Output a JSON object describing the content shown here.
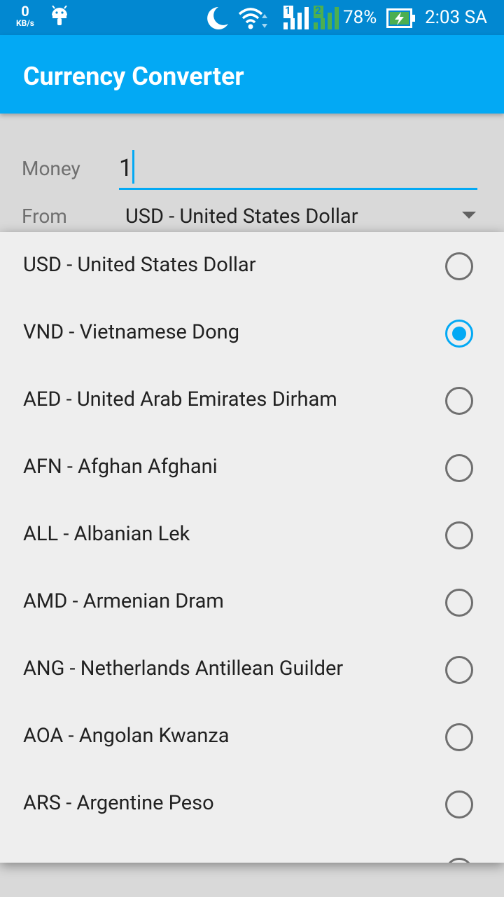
{
  "status_bar": {
    "net_speed": "0",
    "net_unit": "KB/s",
    "icons": [
      "android-icon",
      "moon-icon",
      "wifi-icon",
      "signal-sim1-icon",
      "signal-sim2-icon"
    ],
    "sim1": "1",
    "sim2": "2",
    "battery": "78%",
    "time": "2:03 SA"
  },
  "app_bar": {
    "title": "Currency Converter",
    "color": "#03a9f4"
  },
  "form": {
    "money_label": "Money",
    "money_value": "1",
    "from_label": "From",
    "from_value": "USD - United States Dollar"
  },
  "dialog": {
    "selected_index": 1,
    "options": [
      {
        "label": "USD - United States Dollar"
      },
      {
        "label": "VND - Vietnamese Dong"
      },
      {
        "label": "AED - United Arab Emirates Dirham"
      },
      {
        "label": "AFN - Afghan Afghani"
      },
      {
        "label": "ALL - Albanian Lek"
      },
      {
        "label": "AMD - Armenian Dram"
      },
      {
        "label": "ANG - Netherlands Antillean Guilder"
      },
      {
        "label": "AOA - Angolan Kwanza"
      },
      {
        "label": "ARS - Argentine Peso"
      }
    ]
  }
}
